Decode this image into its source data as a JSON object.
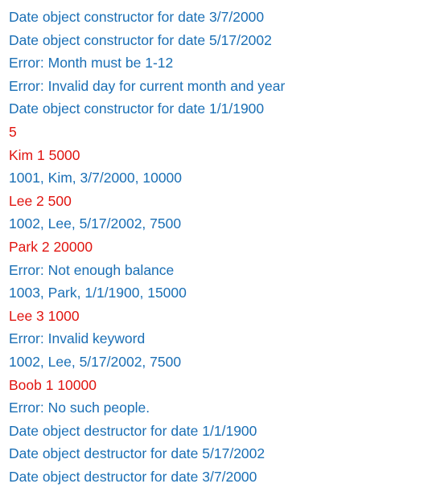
{
  "colors": {
    "output": "#1a6fb5",
    "input": "#e0140f",
    "background": "#ffffff"
  },
  "console": {
    "lines": [
      {
        "kind": "output",
        "text": "Date object constructor for date 3/7/2000"
      },
      {
        "kind": "output",
        "text": "Date object constructor for date 5/17/2002"
      },
      {
        "kind": "output",
        "text": "Error: Month must be 1-12"
      },
      {
        "kind": "output",
        "text": "Error: Invalid day for current month and year"
      },
      {
        "kind": "output",
        "text": "Date object constructor for date 1/1/1900"
      },
      {
        "kind": "input",
        "text": "5"
      },
      {
        "kind": "input",
        "text": "Kim 1 5000"
      },
      {
        "kind": "output",
        "text": "1001, Kim, 3/7/2000, 10000"
      },
      {
        "kind": "input",
        "text": "Lee 2 500"
      },
      {
        "kind": "output",
        "text": "1002, Lee, 5/17/2002, 7500"
      },
      {
        "kind": "input",
        "text": "Park 2 20000"
      },
      {
        "kind": "output",
        "text": "Error: Not enough balance"
      },
      {
        "kind": "output",
        "text": "1003, Park, 1/1/1900, 15000"
      },
      {
        "kind": "input",
        "text": "Lee 3 1000"
      },
      {
        "kind": "output",
        "text": "Error: Invalid keyword"
      },
      {
        "kind": "output",
        "text": "1002, Lee, 5/17/2002, 7500"
      },
      {
        "kind": "input",
        "text": "Boob 1 10000"
      },
      {
        "kind": "output",
        "text": "Error: No such people."
      },
      {
        "kind": "output",
        "text": "Date object destructor for date 1/1/1900"
      },
      {
        "kind": "output",
        "text": "Date object destructor for date 5/17/2002"
      },
      {
        "kind": "output",
        "text": "Date object destructor for date 3/7/2000"
      }
    ]
  }
}
